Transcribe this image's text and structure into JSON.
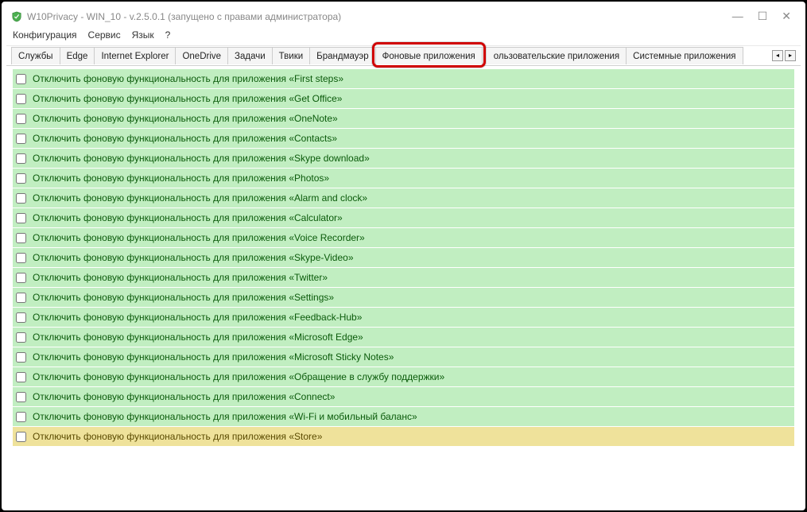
{
  "window": {
    "title": "W10Privacy - WIN_10 - v.2.5.0.1 (запущено с правами администратора)"
  },
  "menu": {
    "items": [
      "Конфигурация",
      "Сервис",
      "Язык",
      "?"
    ]
  },
  "tabs": {
    "items": [
      "Службы",
      "Edge",
      "Internet Explorer",
      "OneDrive",
      "Задачи",
      "Твики",
      "Брандмауэр",
      "Фоновые приложения",
      "Пользовательские приложения",
      "Системные приложения"
    ],
    "active_index": 7
  },
  "rows": [
    {
      "label": "Отключить фоновую функциональность для приложения «First steps»",
      "color": "green"
    },
    {
      "label": "Отключить фоновую функциональность для приложения «Get Office»",
      "color": "green"
    },
    {
      "label": "Отключить фоновую функциональность для приложения «OneNote»",
      "color": "green"
    },
    {
      "label": "Отключить фоновую функциональность для приложения «Contacts»",
      "color": "green"
    },
    {
      "label": "Отключить фоновую функциональность для приложения «Skype download»",
      "color": "green"
    },
    {
      "label": "Отключить фоновую функциональность для приложения «Photos»",
      "color": "green"
    },
    {
      "label": "Отключить фоновую функциональность для приложения «Alarm and clock»",
      "color": "green"
    },
    {
      "label": "Отключить фоновую функциональность для приложения «Calculator»",
      "color": "green"
    },
    {
      "label": "Отключить фоновую функциональность для приложения «Voice Recorder»",
      "color": "green"
    },
    {
      "label": "Отключить фоновую функциональность для приложения «Skype-Video»",
      "color": "green"
    },
    {
      "label": "Отключить фоновую функциональность для приложения «Twitter»",
      "color": "green"
    },
    {
      "label": "Отключить фоновую функциональность для приложения «Settings»",
      "color": "green"
    },
    {
      "label": "Отключить фоновую функциональность для приложения «Feedback-Hub»",
      "color": "green"
    },
    {
      "label": "Отключить фоновую функциональность для приложения «Microsoft Edge»",
      "color": "green"
    },
    {
      "label": "Отключить фоновую функциональность для приложения «Microsoft Sticky Notes»",
      "color": "green"
    },
    {
      "label": "Отключить фоновую функциональность для приложения «Обращение в службу поддержки»",
      "color": "green"
    },
    {
      "label": "Отключить фоновую функциональность для приложения «Connect»",
      "color": "green"
    },
    {
      "label": "Отключить фоновую функциональность для приложения «Wi-Fi и мобильный баланс»",
      "color": "green"
    },
    {
      "label": "Отключить фоновую функциональность для приложения «Store»",
      "color": "yellow"
    }
  ]
}
